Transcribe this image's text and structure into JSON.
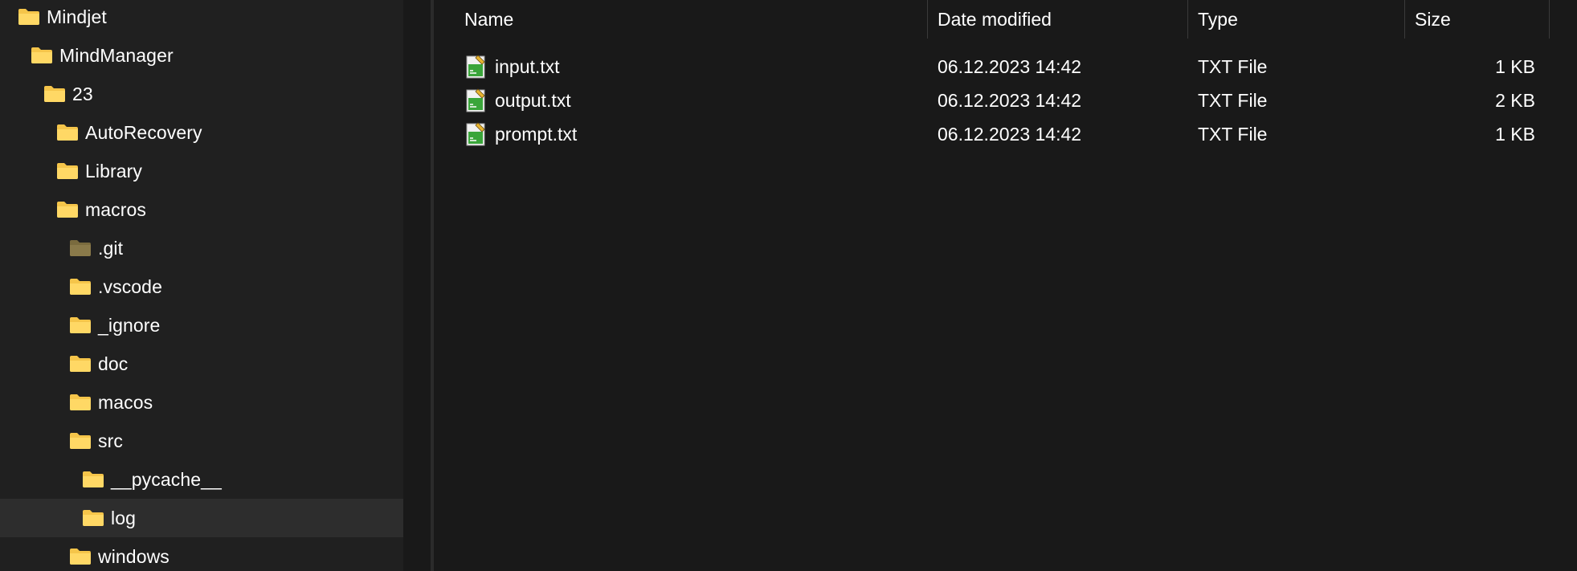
{
  "navigation": {
    "items": [
      {
        "label": "Mindjet"
      },
      {
        "label": "MindManager"
      },
      {
        "label": "23"
      },
      {
        "label": "AutoRecovery"
      },
      {
        "label": "Library"
      },
      {
        "label": "macros"
      },
      {
        "label": ".git"
      },
      {
        "label": ".vscode"
      },
      {
        "label": "_ignore"
      },
      {
        "label": "doc"
      },
      {
        "label": "macos"
      },
      {
        "label": "src"
      },
      {
        "label": "__pycache__"
      },
      {
        "label": "log",
        "selected": true
      },
      {
        "label": "windows"
      }
    ]
  },
  "columns": {
    "name": "Name",
    "date_modified": "Date modified",
    "type": "Type",
    "size": "Size"
  },
  "files": [
    {
      "name": "input.txt",
      "date_modified": "06.12.2023 14:42",
      "type": "TXT File",
      "size": "1 KB",
      "icon": "txt-file-icon"
    },
    {
      "name": "output.txt",
      "date_modified": "06.12.2023 14:42",
      "type": "TXT File",
      "size": "2 KB",
      "icon": "txt-file-icon"
    },
    {
      "name": "prompt.txt",
      "date_modified": "06.12.2023 14:42",
      "type": "TXT File",
      "size": "1 KB",
      "icon": "txt-file-icon"
    }
  ],
  "colors": {
    "background": "#191919",
    "nav_background": "#202020",
    "selected_row": "#2d2d2d",
    "folder_yellow": "#f5c54a",
    "git_folder": "#8a7a4a",
    "text": "#ffffff"
  }
}
